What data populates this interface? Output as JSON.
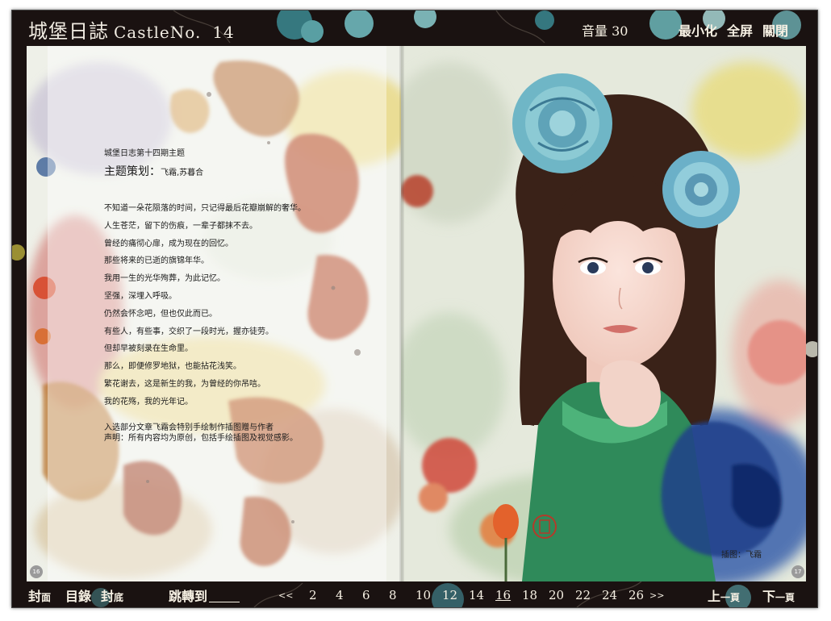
{
  "header": {
    "title_cn": "城堡日誌",
    "title_en": "CastleNo.",
    "issue_no": "14",
    "volume_label": "音量 30",
    "minimize_label": "最小化",
    "fullscreen_label": "全屏",
    "close_label": "關閉"
  },
  "article": {
    "kicker": "城堡日志第十四期主题",
    "planner_label": "主题策划：",
    "planner_names": "飞霜,苏暮合",
    "lines": [
      "不知道一朵花陨落的时间，只记得最后花瓣崩解的奢华。",
      "人生苍茫，留下的伤痕，一辈子都抹不去。",
      "曾经的痛彻心扉，成为现在的回忆。",
      "那些将来的已逝的旗锦年华。",
      "我用一生的光华殉葬，为此记忆。",
      "坚强，深埋入呼吸。",
      "仍然会怀念吧，但也仅此而已。",
      "有些人，有些事，交织了一段时光，握亦徒劳。",
      "但却早被刻录在生命里。",
      "那么，即便修罗地狱，也能拈花浅笑。",
      "繁花谢去，这是新生的我，为曾经的你吊唁。",
      "我的花殇，我的光年记。"
    ],
    "note_1": "入选部分文章飞霜会特别手绘制作插图赠与作者",
    "note_2": "声明：所有内容均为原创，包括手绘插图及视觉感影。"
  },
  "illustration_caption": "插图：飞霜",
  "page_numbers": {
    "left": "16",
    "right": "17"
  },
  "bottom_nav": {
    "cover_label": "封",
    "cover_sm": "面",
    "contents_label": "目錄",
    "back_label": "封",
    "back_sm": "底",
    "jump_label": "跳轉到",
    "jump_value": "",
    "prev_arrow": "<<",
    "pages": [
      "2",
      "4",
      "6",
      "8",
      "10",
      "12",
      "14",
      "16",
      "18",
      "20",
      "22",
      "24",
      "26"
    ],
    "current_page": "16",
    "next_arrow": ">>",
    "prev_page_label": "上",
    "prev_page_sm": "一頁",
    "next_page_label": "下",
    "next_page_sm": "一頁"
  },
  "colors": {
    "frame": "#1a1211",
    "text_light": "#f7f1e4",
    "rust": "#b24a24",
    "ochre": "#d6a43a",
    "teal_rose": "#7fc2c9",
    "ink_blue": "#1f3f8a"
  }
}
